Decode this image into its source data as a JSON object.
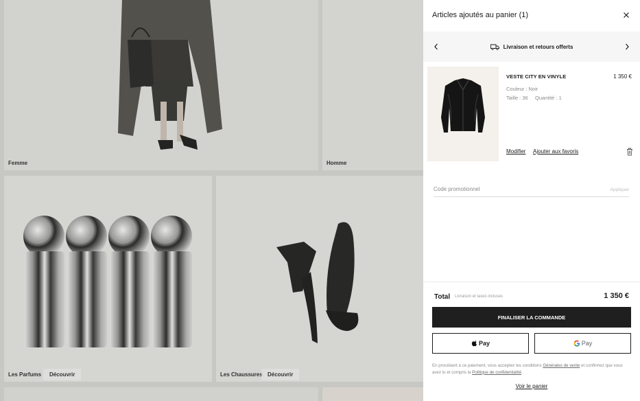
{
  "background": {
    "tiles": {
      "femme": {
        "label": "Femme"
      },
      "homme": {
        "label": "Homme"
      },
      "parfums": {
        "label": "Les Parfums",
        "button": "Découvrir"
      },
      "chaussures": {
        "label": "Les Chaussures",
        "button": "Découvrir"
      }
    }
  },
  "cart": {
    "title": "Articles ajoutés au panier (1)",
    "promo_banner": {
      "text": "Livraison et retours offerts",
      "icon": "truck-icon"
    },
    "item": {
      "name": "VESTE CITY EN VINYLE",
      "price": "1 350 €",
      "color_line": "Couleur : Noir",
      "size_line": "Taille : 36",
      "quantity_line": "Quantité : 1",
      "edit_label": "Modifier",
      "favorite_label": "Ajouter aux favoris"
    },
    "promo_code": {
      "placeholder": "Code promotionnel",
      "apply_label": "Appliquer"
    },
    "total": {
      "label": "Total",
      "sublabel": "Livraison et taxes incluses",
      "value": "1 350 €"
    },
    "checkout_label": "FINALISER LA COMMANDE",
    "apple_pay_label": "Pay",
    "google_pay_label": "Pay",
    "legal": {
      "prefix": "En procédant à ce paiement, vous acceptez les conditions",
      "terms_link": "Générales de vente",
      "middle": "et confirmez que vous avez lu et compris la",
      "privacy_link": "Politique de confidentialité",
      "suffix": "."
    },
    "view_cart_label": "Voir le panier"
  },
  "colors": {
    "checkout_bg": "#1f1f1f",
    "promo_bar_bg": "#f6f6f6",
    "product_bg": "#f4f0eb"
  }
}
